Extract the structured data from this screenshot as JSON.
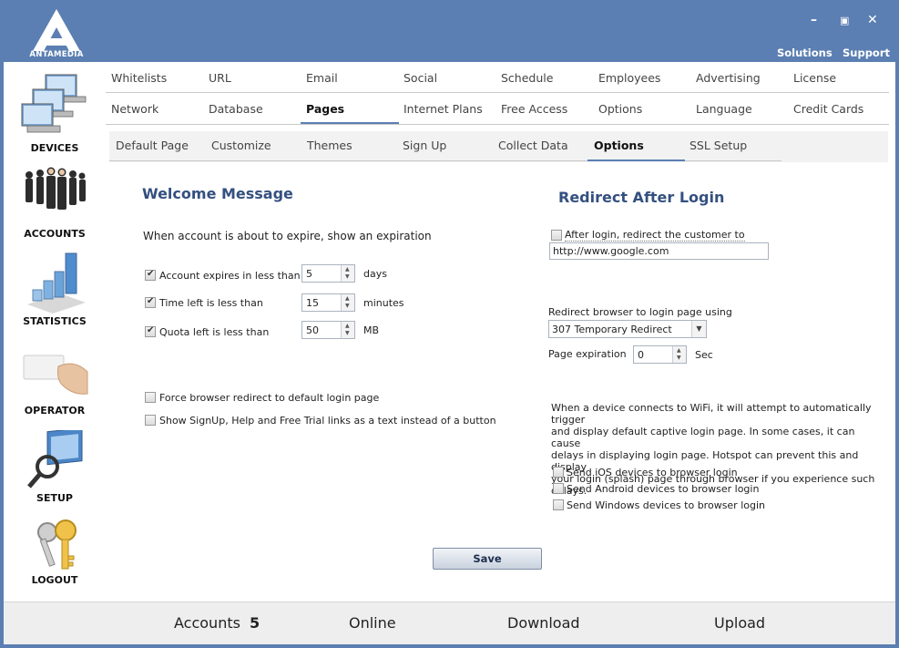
{
  "brand": {
    "logo_text": "ANTAMEDIA"
  },
  "window": {
    "minimize": "–",
    "restore": "▣",
    "close": "✕"
  },
  "top_links": {
    "solutions": "Solutions",
    "support": "Support"
  },
  "sidebar": {
    "items": [
      {
        "label": "DEVICES",
        "icon": "devices-icon"
      },
      {
        "label": "ACCOUNTS",
        "icon": "accounts-icon"
      },
      {
        "label": "STATISTICS",
        "icon": "statistics-icon"
      },
      {
        "label": "OPERATOR",
        "icon": "operator-icon"
      },
      {
        "label": "SETUP",
        "icon": "setup-icon"
      },
      {
        "label": "LOGOUT",
        "icon": "logout-icon"
      }
    ]
  },
  "tabs_row1": [
    "Whitelists",
    "URL",
    "Email",
    "Social",
    "Schedule",
    "Employees",
    "Advertising",
    "License"
  ],
  "tabs_row2": [
    "Network",
    "Database",
    "Pages",
    "Internet Plans",
    "Free Access",
    "Options",
    "Language",
    "Credit Cards"
  ],
  "tabs_row2_active": "Pages",
  "subtabs": [
    "Default Page",
    "Customize",
    "Themes",
    "Sign Up",
    "Collect Data",
    "Options",
    "SSL Setup"
  ],
  "subtabs_active": "Options",
  "welcome": {
    "heading": "Welcome Message",
    "intro": "When account is about to expire, show an expiration",
    "rows": [
      {
        "label": "Account expires in less than",
        "checked": true,
        "value": "5",
        "unit": "days"
      },
      {
        "label": "Time left is less than",
        "checked": true,
        "value": "15",
        "unit": "minutes"
      },
      {
        "label": "Quota left is less than",
        "checked": true,
        "value": "50",
        "unit": "MB"
      }
    ],
    "force_redirect": {
      "label": "Force browser redirect to default login page",
      "checked": false
    },
    "show_links": {
      "label": "Show SignUp, Help and Free Trial links as a text instead of a button",
      "checked": false
    }
  },
  "redirect": {
    "heading": "Redirect After Login",
    "after_login": {
      "label": "After login, redirect the customer to",
      "checked": false
    },
    "url_value": "http://www.google.com",
    "method_label": "Redirect browser to login page using",
    "method_value": "307 Temporary Redirect",
    "expiration_label": "Page expiration",
    "expiration_value": "0",
    "expiration_unit": "Sec",
    "info_lines": [
      "When a device connects to WiFi, it will attempt to automatically trigger",
      "and display default captive login page. In some cases, it can cause",
      "delays in displaying login page. Hotspot can prevent this and display",
      "your login (splash) page through browser if you experience such delays."
    ],
    "device_options": [
      {
        "label": "Send iOS devices to browser login",
        "checked": false
      },
      {
        "label": "Send Android devices to browser login",
        "checked": false
      },
      {
        "label": "Send Windows devices to browser login",
        "checked": false
      }
    ]
  },
  "save_label": "Save",
  "footer": {
    "accounts_label": "Accounts",
    "accounts_count": "5",
    "online_label": "Online",
    "download_label": "Download",
    "upload_label": "Upload"
  },
  "colors": {
    "titlebar": "#5b7fb2",
    "heading": "#34507f"
  }
}
